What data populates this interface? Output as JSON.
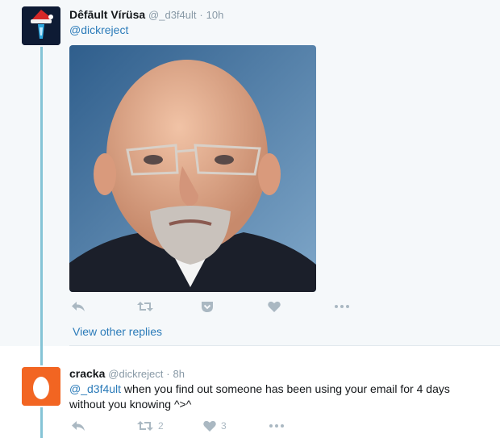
{
  "tweet1": {
    "display_name": "Dêfāult Vírüsa",
    "handle": "@_d3f4ult",
    "separator": "·",
    "time": "10h",
    "reply_to": "@dickreject",
    "image_alt": "photo of a bald man with glasses and a white goatee",
    "actions": {
      "reply_icon": "reply-icon",
      "retweet_icon": "retweet-icon",
      "pocket_icon": "pocket-icon",
      "like_icon": "heart-icon",
      "more_icon": "more-icon"
    }
  },
  "view_other_replies": "View other replies",
  "tweet2": {
    "display_name": "cracka",
    "handle": "@dickreject",
    "separator": "·",
    "time": "8h",
    "mention": "@_d3f4ult",
    "text": " when you find out someone has been using your email for 4 days without you knowing ^>^",
    "retweet_count": "2",
    "like_count": "3"
  },
  "colors": {
    "link": "#2b7bb9",
    "thread_line": "#85c4d6",
    "icon": "#aab8c2",
    "egg_avatar": "#f26522"
  }
}
